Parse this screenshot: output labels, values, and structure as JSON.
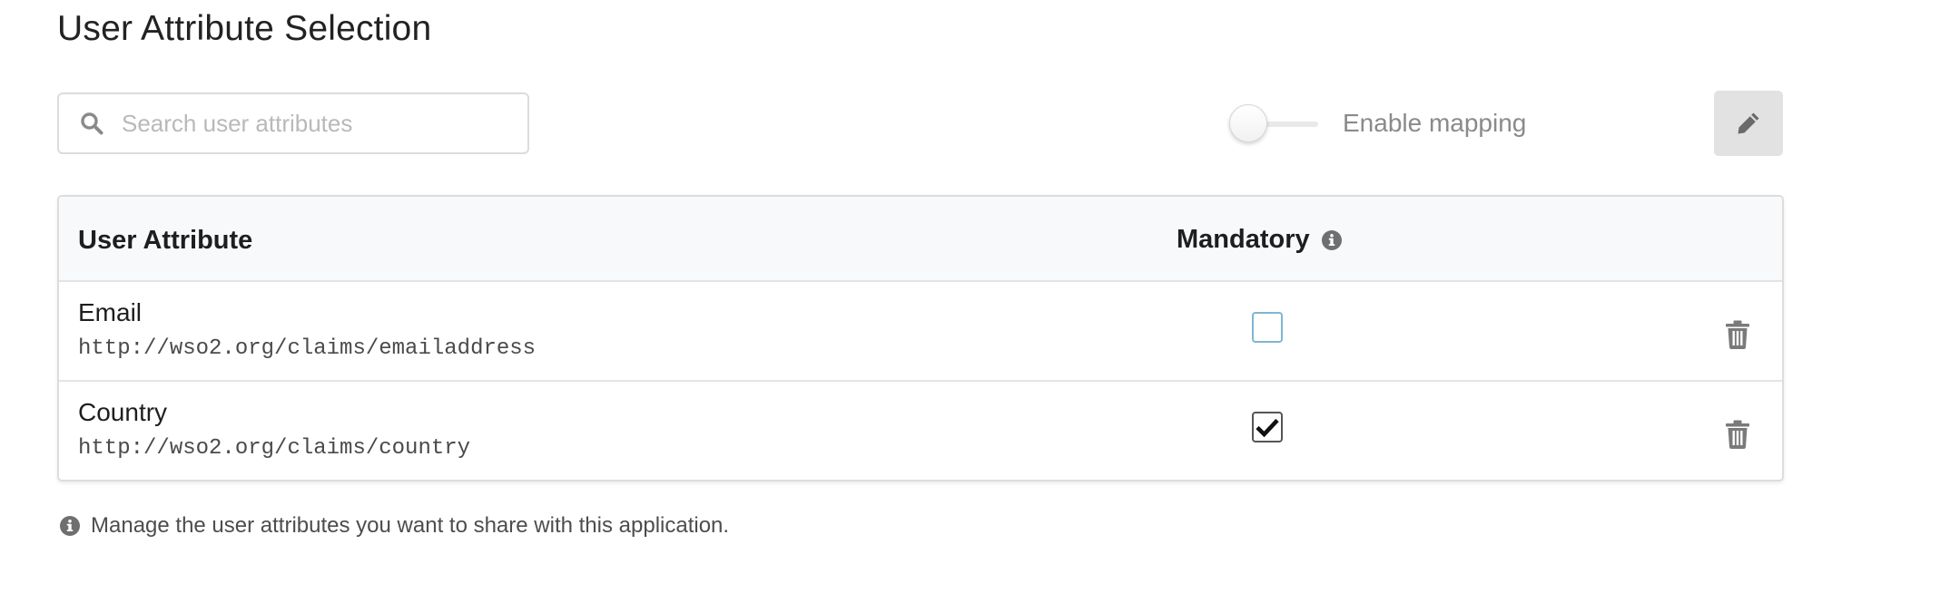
{
  "page": {
    "title": "User Attribute Selection"
  },
  "toolbar": {
    "search_placeholder": "Search user attributes",
    "search_value": "",
    "mapping_toggle_label": "Enable mapping",
    "mapping_enabled": false,
    "edit_icon": "pencil-icon"
  },
  "table": {
    "headers": {
      "attribute": "User Attribute",
      "mandatory": "Mandatory"
    },
    "rows": [
      {
        "name": "Email",
        "uri": "http://wso2.org/claims/emailaddress",
        "mandatory": false
      },
      {
        "name": "Country",
        "uri": "http://wso2.org/claims/country",
        "mandatory": true
      }
    ]
  },
  "hint": {
    "text": "Manage the user attributes you want to share with this application."
  },
  "colors": {
    "icon_gray": "#7a7a7a",
    "checkbox_focus_border": "#7fb6d4",
    "header_bg": "#f8f9fa"
  }
}
